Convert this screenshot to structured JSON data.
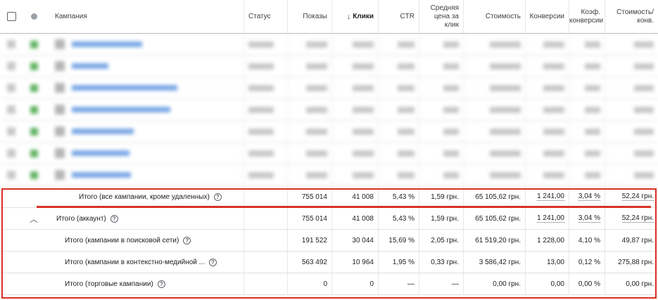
{
  "header": {
    "campaign": "Кампания",
    "status": "Статус",
    "impressions": "Показы",
    "clicks": "Клики",
    "ctr": "CTR",
    "avg_cpc": "Средняя цена за клик",
    "cost": "Стоимость",
    "conversions": "Конверсии",
    "conv_rate": "Коэф. конверсии",
    "cost_per_conv": "Стоимость/ конв.",
    "sort_icon": "arrow-down-icon"
  },
  "totals": [
    {
      "label": "Итого (все кампании, кроме удаленных)",
      "impressions": "755 014",
      "clicks": "41 008",
      "ctr": "5,43 %",
      "avg_cpc": "1,59 грн.",
      "cost": "65 105,62 грн.",
      "conversions": "1 241,00",
      "conv_rate": "3,04 %",
      "cost_per_conv": "52,24 грн."
    },
    {
      "label": "Итого (аккаунт)",
      "impressions": "755 014",
      "clicks": "41 008",
      "ctr": "5,43 %",
      "avg_cpc": "1,59 грн.",
      "cost": "65 105,62 грн.",
      "conversions": "1 241,00",
      "conv_rate": "3,04 %",
      "cost_per_conv": "52,24 грн."
    },
    {
      "label": "Итого (кампании в поисковой сети)",
      "impressions": "191 522",
      "clicks": "30 044",
      "ctr": "15,69 %",
      "avg_cpc": "2,05 грн.",
      "cost": "61 519,20 грн.",
      "conversions": "1 228,00",
      "conv_rate": "4,10 %",
      "cost_per_conv": "49,87 грн."
    },
    {
      "label": "Итого (кампании в контекстно-медийной ...",
      "impressions": "563 492",
      "clicks": "10 964",
      "ctr": "1,95 %",
      "avg_cpc": "0,33 грн.",
      "cost": "3 586,42 грн.",
      "conversions": "13,00",
      "conv_rate": "0,12 %",
      "cost_per_conv": "275,88 грн."
    },
    {
      "label": "Итого (торговые кампании)",
      "impressions": "0",
      "clicks": "0",
      "ctr": "—",
      "avg_cpc": "—",
      "cost": "0,00 грн.",
      "conversions": "0,00",
      "conv_rate": "0,00 %",
      "cost_per_conv": "0,00 грн."
    }
  ],
  "accent": {
    "highlight": "#d93025",
    "link": "#1a73e8",
    "enabled": "#63b463"
  }
}
